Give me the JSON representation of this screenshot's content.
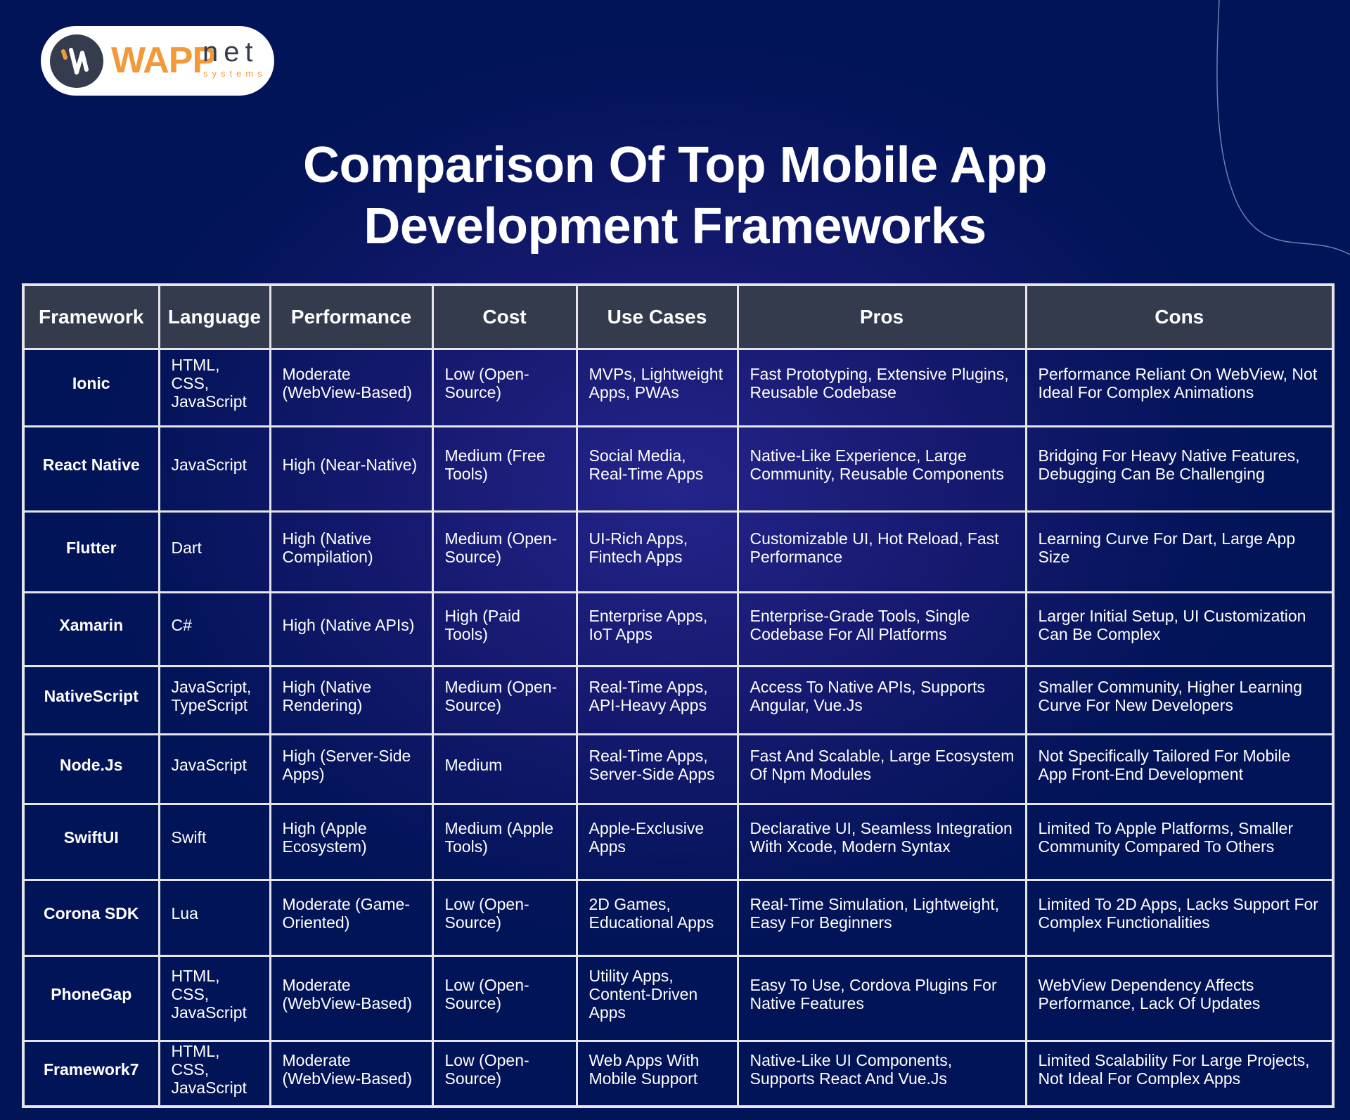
{
  "logo": {
    "brand_primary": "WAPP",
    "brand_secondary": "net",
    "brand_tagline": "systems",
    "accent_color": "#f29a3a",
    "dark_color": "#353c4d"
  },
  "title": {
    "line1": "Comparison Of Top Mobile App",
    "line2": "Development Frameworks"
  },
  "table": {
    "headers": [
      "Framework",
      "Language",
      "Performance",
      "Cost",
      "Use Cases",
      "Pros",
      "Cons"
    ],
    "rows": [
      [
        "Ionic",
        "HTML, CSS, JavaScript",
        "Moderate (WebView-Based)",
        "Low (Open-Source)",
        "MVPs, Lightweight Apps, PWAs",
        "Fast Prototyping, Extensive Plugins, Reusable Codebase",
        "Performance Reliant On WebView, Not Ideal For Complex Animations"
      ],
      [
        "React Native",
        "JavaScript",
        "High (Near-Native)",
        "Medium (Free Tools)",
        "Social Media, Real-Time Apps",
        "Native-Like Experience, Large Community, Reusable Components",
        "Bridging For Heavy Native Features, Debugging Can Be Challenging"
      ],
      [
        "Flutter",
        "Dart",
        "High (Native Compilation)",
        "Medium (Open-Source)",
        "UI-Rich Apps, Fintech Apps",
        "Customizable UI, Hot Reload, Fast Performance",
        "Learning Curve For Dart, Large App Size"
      ],
      [
        "Xamarin",
        "C#",
        "High (Native APIs)",
        "High (Paid Tools)",
        "Enterprise Apps, IoT Apps",
        "Enterprise-Grade Tools, Single Codebase For All Platforms",
        "Larger Initial Setup, UI Customization Can Be Complex"
      ],
      [
        "NativeScript",
        "JavaScript, TypeScript",
        "High (Native Rendering)",
        "Medium (Open-Source)",
        "Real-Time Apps, API-Heavy Apps",
        "Access To Native APIs, Supports Angular, Vue.Js",
        "Smaller Community, Higher Learning Curve For New Developers"
      ],
      [
        "Node.Js",
        "JavaScript",
        "High (Server-Side Apps)",
        "Medium",
        "Real-Time Apps, Server-Side Apps",
        "Fast And Scalable, Large Ecosystem Of Npm Modules",
        "Not Specifically Tailored For Mobile App Front-End Development"
      ],
      [
        "SwiftUI",
        "Swift",
        "High (Apple Ecosystem)",
        "Medium (Apple Tools)",
        "Apple-Exclusive Apps",
        "Declarative UI, Seamless Integration With Xcode, Modern Syntax",
        "Limited To Apple Platforms, Smaller Community Compared To Others"
      ],
      [
        "Corona SDK",
        "Lua",
        "Moderate (Game-Oriented)",
        "Low (Open-Source)",
        "2D Games, Educational Apps",
        "Real-Time Simulation, Lightweight, Easy For Beginners",
        "Limited To 2D Apps, Lacks Support For Complex Functionalities"
      ],
      [
        "PhoneGap",
        "HTML, CSS, JavaScript",
        "Moderate (WebView-Based)",
        "Low (Open-Source)",
        "Utility Apps, Content-Driven Apps",
        "Easy To Use, Cordova Plugins For Native Features",
        "WebView Dependency Affects Performance, Lack Of Updates"
      ],
      [
        "Framework7",
        "HTML, CSS, JavaScript",
        "Moderate (WebView-Based)",
        "Low (Open-Source)",
        "Web Apps With Mobile Support",
        "Native-Like UI Components, Supports React And Vue.Js",
        "Limited Scalability For Large Projects, Not Ideal For Complex Apps"
      ]
    ]
  }
}
